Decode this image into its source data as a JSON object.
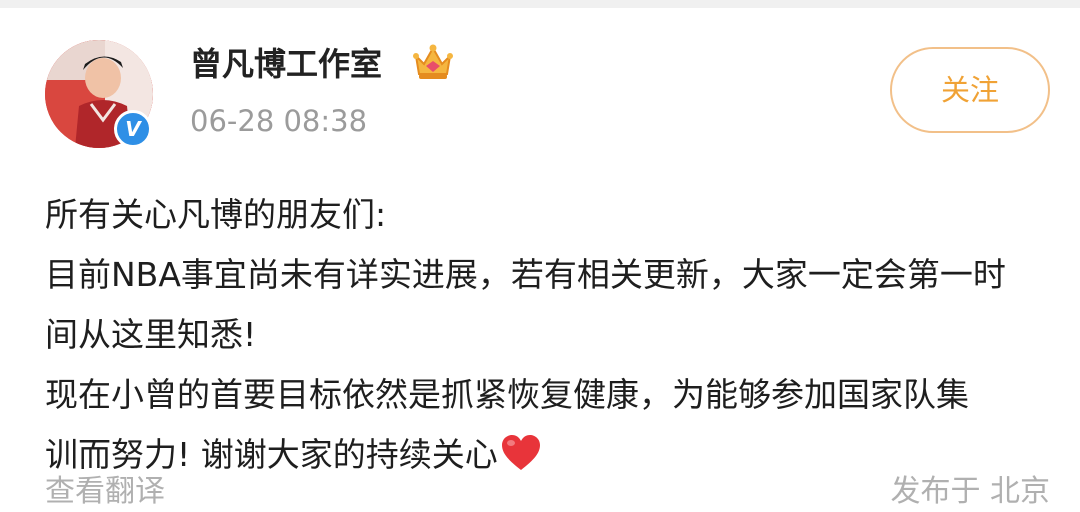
{
  "post": {
    "author": "曾凡博工作室",
    "timestamp": "06-28 08:38",
    "follow_label": "关注",
    "verified_badge": "V",
    "lines": [
      "所有关心凡博的朋友们:",
      "目前NBA事宜尚未有详实进展，若有相关更新，大家一定会第一时",
      "间从这里知悉!",
      "现在小曾的首要目标依然是抓紧恢复健康，为能够参加国家队集",
      "训而努力! 谢谢大家的持续关心"
    ],
    "emoji": "heart-icon"
  },
  "footer": {
    "translate_label": "查看翻译",
    "location_label": "发布于 北京"
  },
  "colors": {
    "accent": "#f0a235",
    "follow_border": "#f2c089",
    "verified": "#2e8fe6",
    "muted_text": "#9b9b9b",
    "heart": "#e8343a"
  },
  "icons": {
    "avatar": "avatar",
    "crown": "crown-badge-icon",
    "verified": "verified-badge-icon",
    "heart": "heart-icon"
  }
}
